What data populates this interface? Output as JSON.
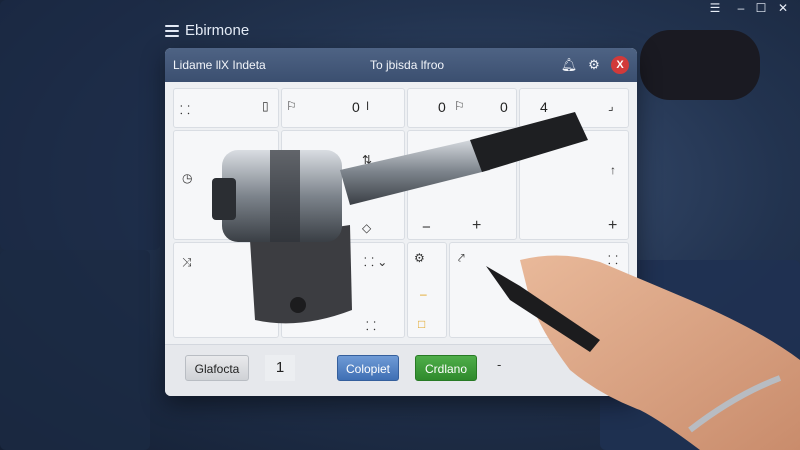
{
  "os_bar": {
    "menu_icon": "hamburger-icon",
    "minimize_icon": "minimize-icon",
    "maximize_icon": "maximize-icon",
    "close_icon": "close-icon"
  },
  "app": {
    "brand_title": "Ebirmone",
    "brand_icon": "stack-icon"
  },
  "window": {
    "title_left": "Lidame llX Indeta",
    "title_center": "To jbisda lfroo",
    "bell_icon": "bell-icon",
    "settings_icon": "gear-icon",
    "close_label": "X"
  },
  "grid": {
    "top_numbers": [
      "0",
      "0",
      "0",
      "4"
    ],
    "plus_labels": [
      "+",
      "+"
    ],
    "minus_label": "−"
  },
  "bottom": {
    "gray_button": "Glafocta",
    "counter_value": "1",
    "blue_button": "Colopiet",
    "green_button": "Crdlano",
    "dash_label": "-"
  },
  "colors": {
    "titlebar": "#45597a",
    "blue_button": "#4f7fc4",
    "green_button": "#3c9a38",
    "close": "#d23a3a",
    "accent": "#e0a21a"
  }
}
